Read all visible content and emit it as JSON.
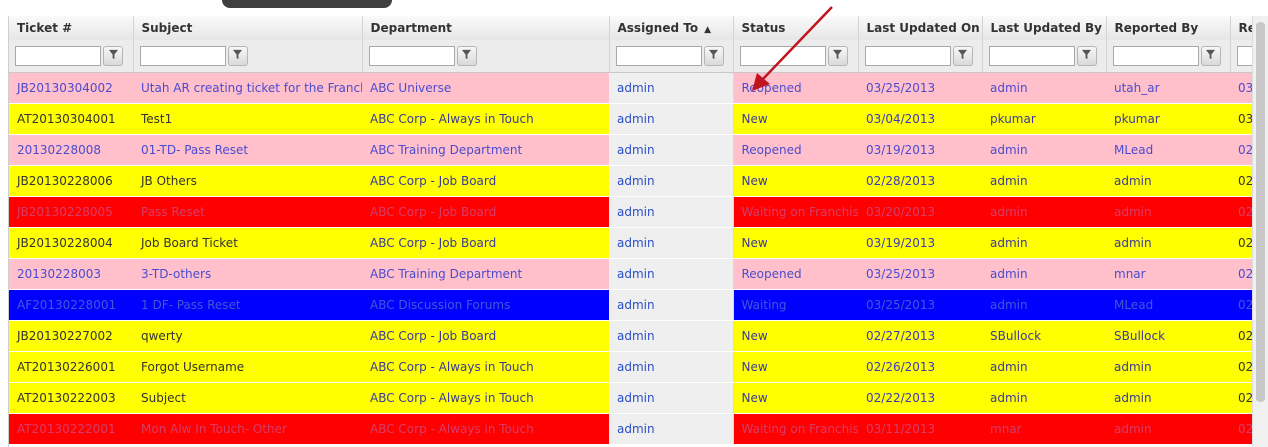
{
  "columns": {
    "ticket": "Ticket #",
    "subject": "Subject",
    "department": "Department",
    "assigned_to": "Assigned To",
    "status": "Status",
    "last_updated_on": "Last Updated On",
    "last_updated_by": "Last Updated By",
    "reported_by": "Reported By",
    "extra": "Re"
  },
  "sort": {
    "column": "assigned_to",
    "direction": "ascending",
    "indicator": "▲"
  },
  "filters": {
    "ticket": "",
    "subject": "",
    "department": "",
    "assigned_to": "",
    "status": "",
    "last_updated_on": "",
    "last_updated_by": "",
    "reported_by": ""
  },
  "colors": {
    "pink": "#ffc0cb",
    "yellow": "#ffff00",
    "red": "#ff0000",
    "blue": "#0000ff",
    "annotation_arrow": "#c0141e"
  },
  "rows": [
    {
      "color": "pink",
      "ticket": "JB20130304002",
      "subject": "Utah AR creating ticket for the Franchise.",
      "department": "ABC Universe",
      "assigned_to": "admin",
      "status": "Reopened",
      "last_updated_on": "03/25/2013",
      "last_updated_by": "admin",
      "reported_by": "utah_ar",
      "extra": "03/"
    },
    {
      "color": "yellow",
      "ticket": "AT20130304001",
      "subject": "Test1",
      "department": "ABC Corp - Always in Touch",
      "assigned_to": "admin",
      "status": "New",
      "last_updated_on": "03/04/2013",
      "last_updated_by": "pkumar",
      "reported_by": "pkumar",
      "extra": "03/"
    },
    {
      "color": "pink",
      "ticket": "20130228008",
      "subject": "01-TD- Pass Reset",
      "department": "ABC Training Department",
      "assigned_to": "admin",
      "status": "Reopened",
      "last_updated_on": "03/19/2013",
      "last_updated_by": "admin",
      "reported_by": "MLead",
      "extra": "02/"
    },
    {
      "color": "yellow",
      "ticket": "JB20130228006",
      "subject": "JB Others",
      "department": "ABC Corp - Job Board",
      "assigned_to": "admin",
      "status": "New",
      "last_updated_on": "02/28/2013",
      "last_updated_by": "admin",
      "reported_by": "admin",
      "extra": "02/"
    },
    {
      "color": "red",
      "ticket": "JB20130228005",
      "subject": "Pass Reset",
      "department": "ABC Corp - Job Board",
      "assigned_to": "admin",
      "status": "Waiting on Franchise",
      "last_updated_on": "03/20/2013",
      "last_updated_by": "admin",
      "reported_by": "admin",
      "extra": "02/"
    },
    {
      "color": "yellow",
      "ticket": "JB20130228004",
      "subject": "Job Board Ticket",
      "department": "ABC Corp - Job Board",
      "assigned_to": "admin",
      "status": "New",
      "last_updated_on": "03/19/2013",
      "last_updated_by": "admin",
      "reported_by": "admin",
      "extra": "02/"
    },
    {
      "color": "pink",
      "ticket": "20130228003",
      "subject": "3-TD-others",
      "department": "ABC Training Department",
      "assigned_to": "admin",
      "status": "Reopened",
      "last_updated_on": "03/25/2013",
      "last_updated_by": "admin",
      "reported_by": "mnar",
      "extra": "02/"
    },
    {
      "color": "blue",
      "ticket": "AF20130228001",
      "subject": "1 DF- Pass Reset",
      "department": "ABC Discussion Forums",
      "assigned_to": "admin",
      "status": "Waiting",
      "last_updated_on": "03/25/2013",
      "last_updated_by": "admin",
      "reported_by": "MLead",
      "extra": "02/"
    },
    {
      "color": "yellow",
      "ticket": "JB20130227002",
      "subject": "qwerty",
      "department": "ABC Corp - Job Board",
      "assigned_to": "admin",
      "status": "New",
      "last_updated_on": "02/27/2013",
      "last_updated_by": "SBullock",
      "reported_by": "SBullock",
      "extra": "02/"
    },
    {
      "color": "yellow",
      "ticket": "AT20130226001",
      "subject": "Forgot Username",
      "department": "ABC Corp - Always in Touch",
      "assigned_to": "admin",
      "status": "New",
      "last_updated_on": "02/26/2013",
      "last_updated_by": "admin",
      "reported_by": "admin",
      "extra": "02/"
    },
    {
      "color": "yellow",
      "ticket": "AT20130222003",
      "subject": "Subject",
      "department": "ABC Corp - Always in Touch",
      "assigned_to": "admin",
      "status": "New",
      "last_updated_on": "02/22/2013",
      "last_updated_by": "admin",
      "reported_by": "admin",
      "extra": "02/"
    },
    {
      "color": "red",
      "ticket": "AT20130222001",
      "subject": "Mon Alw In Touch- Other",
      "department": "ABC Corp - Always in Touch",
      "assigned_to": "admin",
      "status": "Waiting on Franchise",
      "last_updated_on": "03/11/2013",
      "last_updated_by": "mnar",
      "reported_by": "admin",
      "extra": "02/"
    }
  ]
}
